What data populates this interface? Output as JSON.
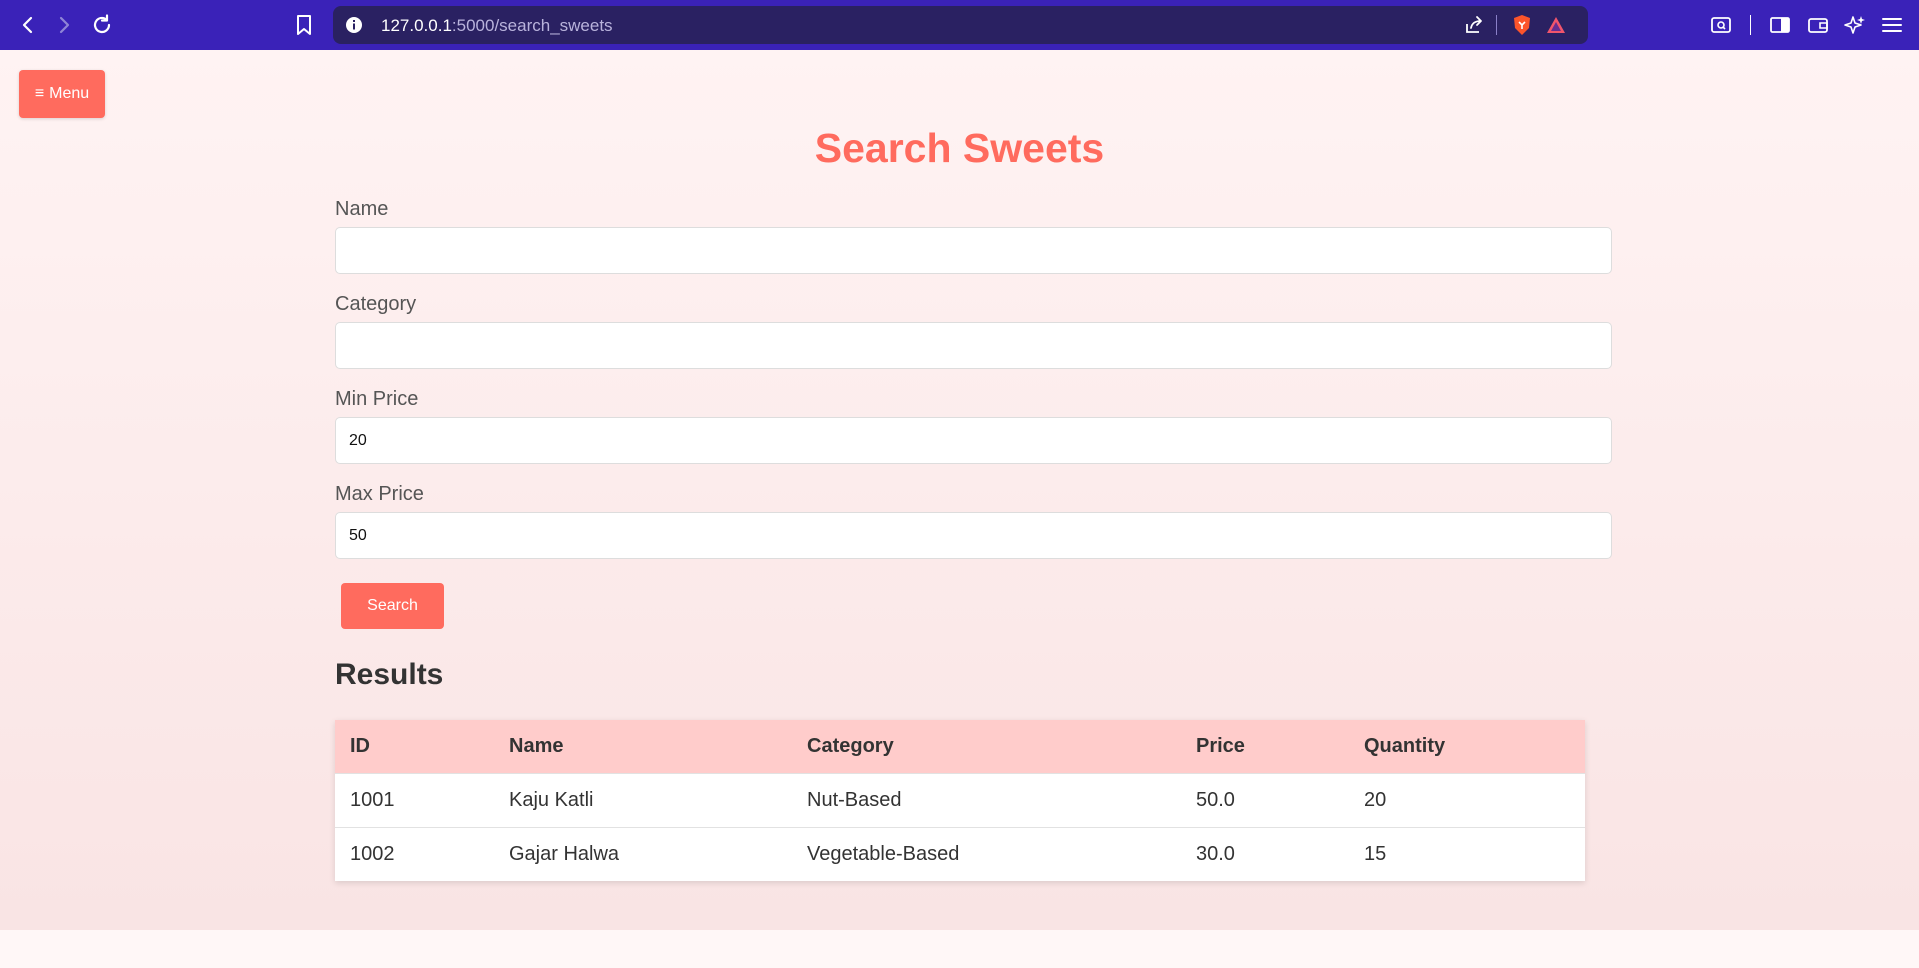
{
  "browser": {
    "url_host": "127.0.0.1",
    "url_path": ":5000/search_sweets"
  },
  "menu": {
    "icon": "≡",
    "label": "Menu"
  },
  "title": "Search Sweets",
  "form": {
    "name_label": "Name",
    "name_value": "",
    "category_label": "Category",
    "category_value": "",
    "min_price_label": "Min Price",
    "min_price_value": "20",
    "max_price_label": "Max Price",
    "max_price_value": "50",
    "search_label": "Search"
  },
  "results": {
    "title": "Results",
    "columns": [
      "ID",
      "Name",
      "Category",
      "Price",
      "Quantity"
    ],
    "rows": [
      [
        "1001",
        "Kaju Katli",
        "Nut-Based",
        "50.0",
        "20"
      ],
      [
        "1002",
        "Gajar Halwa",
        "Vegetable-Based",
        "30.0",
        "15"
      ]
    ]
  },
  "colors": {
    "accent": "#ff6b5e",
    "browser_bar": "#3a22b8",
    "table_header": "#ffcccb"
  }
}
